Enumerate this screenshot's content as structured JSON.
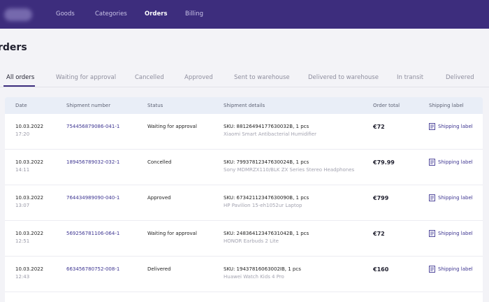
{
  "nav": {
    "items": [
      {
        "label": "Goods",
        "active": false
      },
      {
        "label": "Categories",
        "active": false
      },
      {
        "label": "Orders",
        "active": true
      },
      {
        "label": "Billing",
        "active": false
      }
    ]
  },
  "page": {
    "title": "rders"
  },
  "tabs": [
    {
      "label": "All orders",
      "active": true
    },
    {
      "label": "Waiting for approval",
      "active": false
    },
    {
      "label": "Cancelled",
      "active": false
    },
    {
      "label": "Approved",
      "active": false
    },
    {
      "label": "Sent to warehouse",
      "active": false
    },
    {
      "label": "Delivered to warehouse",
      "active": false
    },
    {
      "label": "In transit",
      "active": false
    },
    {
      "label": "Delivered",
      "active": false
    }
  ],
  "table": {
    "columns": [
      "Date",
      "Shipment number",
      "Status",
      "Shipment details",
      "Order total",
      "Shipping label"
    ],
    "rows": [
      {
        "date": "10.03.2022",
        "time": "17:20",
        "shipment": "754456879086-041-1",
        "status": "Waiting for approval",
        "sku": "SKU: 88126494177630032B, 1 pcs",
        "product": "Xiaomi Smart Antibacterial Humidifier",
        "total": "€72",
        "label": "Shipping label"
      },
      {
        "date": "10.03.2022",
        "time": "14:11",
        "shipment": "189456789032-032-1",
        "status": "Concelled",
        "sku": "SKU: 79937812347630024B, 1 pcs",
        "product": "Sony MDMRZX110/BLK ZX Series Stereo Headphones",
        "total": "€79.99",
        "label": "Shipping label"
      },
      {
        "date": "10.03.2022",
        "time": "13:07",
        "shipment": "764434989090-040-1",
        "status": "Approved",
        "sku": "SKU: 67342112347630090B, 1 pcs",
        "product": "HP Pavilion 15-eh1052ur Laptop",
        "total": "€799",
        "label": "Shipping label"
      },
      {
        "date": "10.03.2022",
        "time": "12:51",
        "shipment": "569256781106-064-1",
        "status": "Waiting for approval",
        "sku": "SKU: 24836412347631042B, 1 pcs",
        "product": "HONOR Earbuds 2 Lite",
        "total": "€72",
        "label": "Shipping label"
      },
      {
        "date": "10.03.2022",
        "time": "12:43",
        "shipment": "663456780752-008-1",
        "status": "Delivered",
        "sku": "SKU: 19437816063002IB, 1 pcs",
        "product": "Huawei Watch Kids 4 Pro",
        "total": "€160",
        "label": "Shipping label"
      }
    ]
  },
  "colors": {
    "brand": "#3d2d7d",
    "link": "#3d3591",
    "table_header": "#e9eef7"
  },
  "icons": {
    "label_icon": "document-icon"
  }
}
